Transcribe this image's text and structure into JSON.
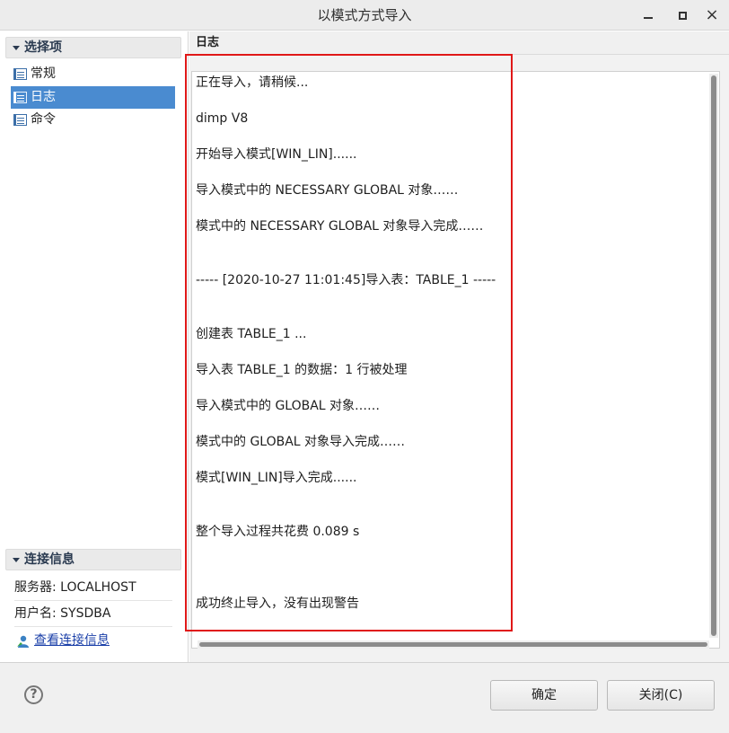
{
  "window": {
    "title": "以模式方式导入"
  },
  "sidebar": {
    "options_header": "选择项",
    "items": [
      {
        "label": "常规",
        "active": false
      },
      {
        "label": "日志",
        "active": true
      },
      {
        "label": "命令",
        "active": false
      }
    ],
    "connection_header": "连接信息",
    "server": "服务器: LOCALHOST",
    "user": "用户名: SYSDBA",
    "view_link": "查看连接信息"
  },
  "log": {
    "header": "日志",
    "lines": [
      "正在导入，请稍候...",
      "dimp V8",
      "开始导入模式[WIN_LIN]......",
      "导入模式中的  NECESSARY GLOBAL 对象……",
      "模式中的  NECESSARY GLOBAL 对象导入完成……",
      "-----  [2020-10-27 11:01:45]导入表：TABLE_1 -----",
      "创建表  TABLE_1 ...",
      "导入表  TABLE_1 的数据：1 行被处理",
      "导入模式中的  GLOBAL 对象……",
      "模式中的  GLOBAL 对象导入完成……",
      "模式[WIN_LIN]导入完成......",
      "整个导入过程共花费      0.089 s",
      "成功终止导入，没有出现警告"
    ]
  },
  "footer": {
    "help_label": "?",
    "ok_label": "确定",
    "close_label": "关闭(C)"
  },
  "colors": {
    "accent": "#4a8bd0",
    "highlight": "#e01818",
    "link": "#1a3fa8"
  }
}
